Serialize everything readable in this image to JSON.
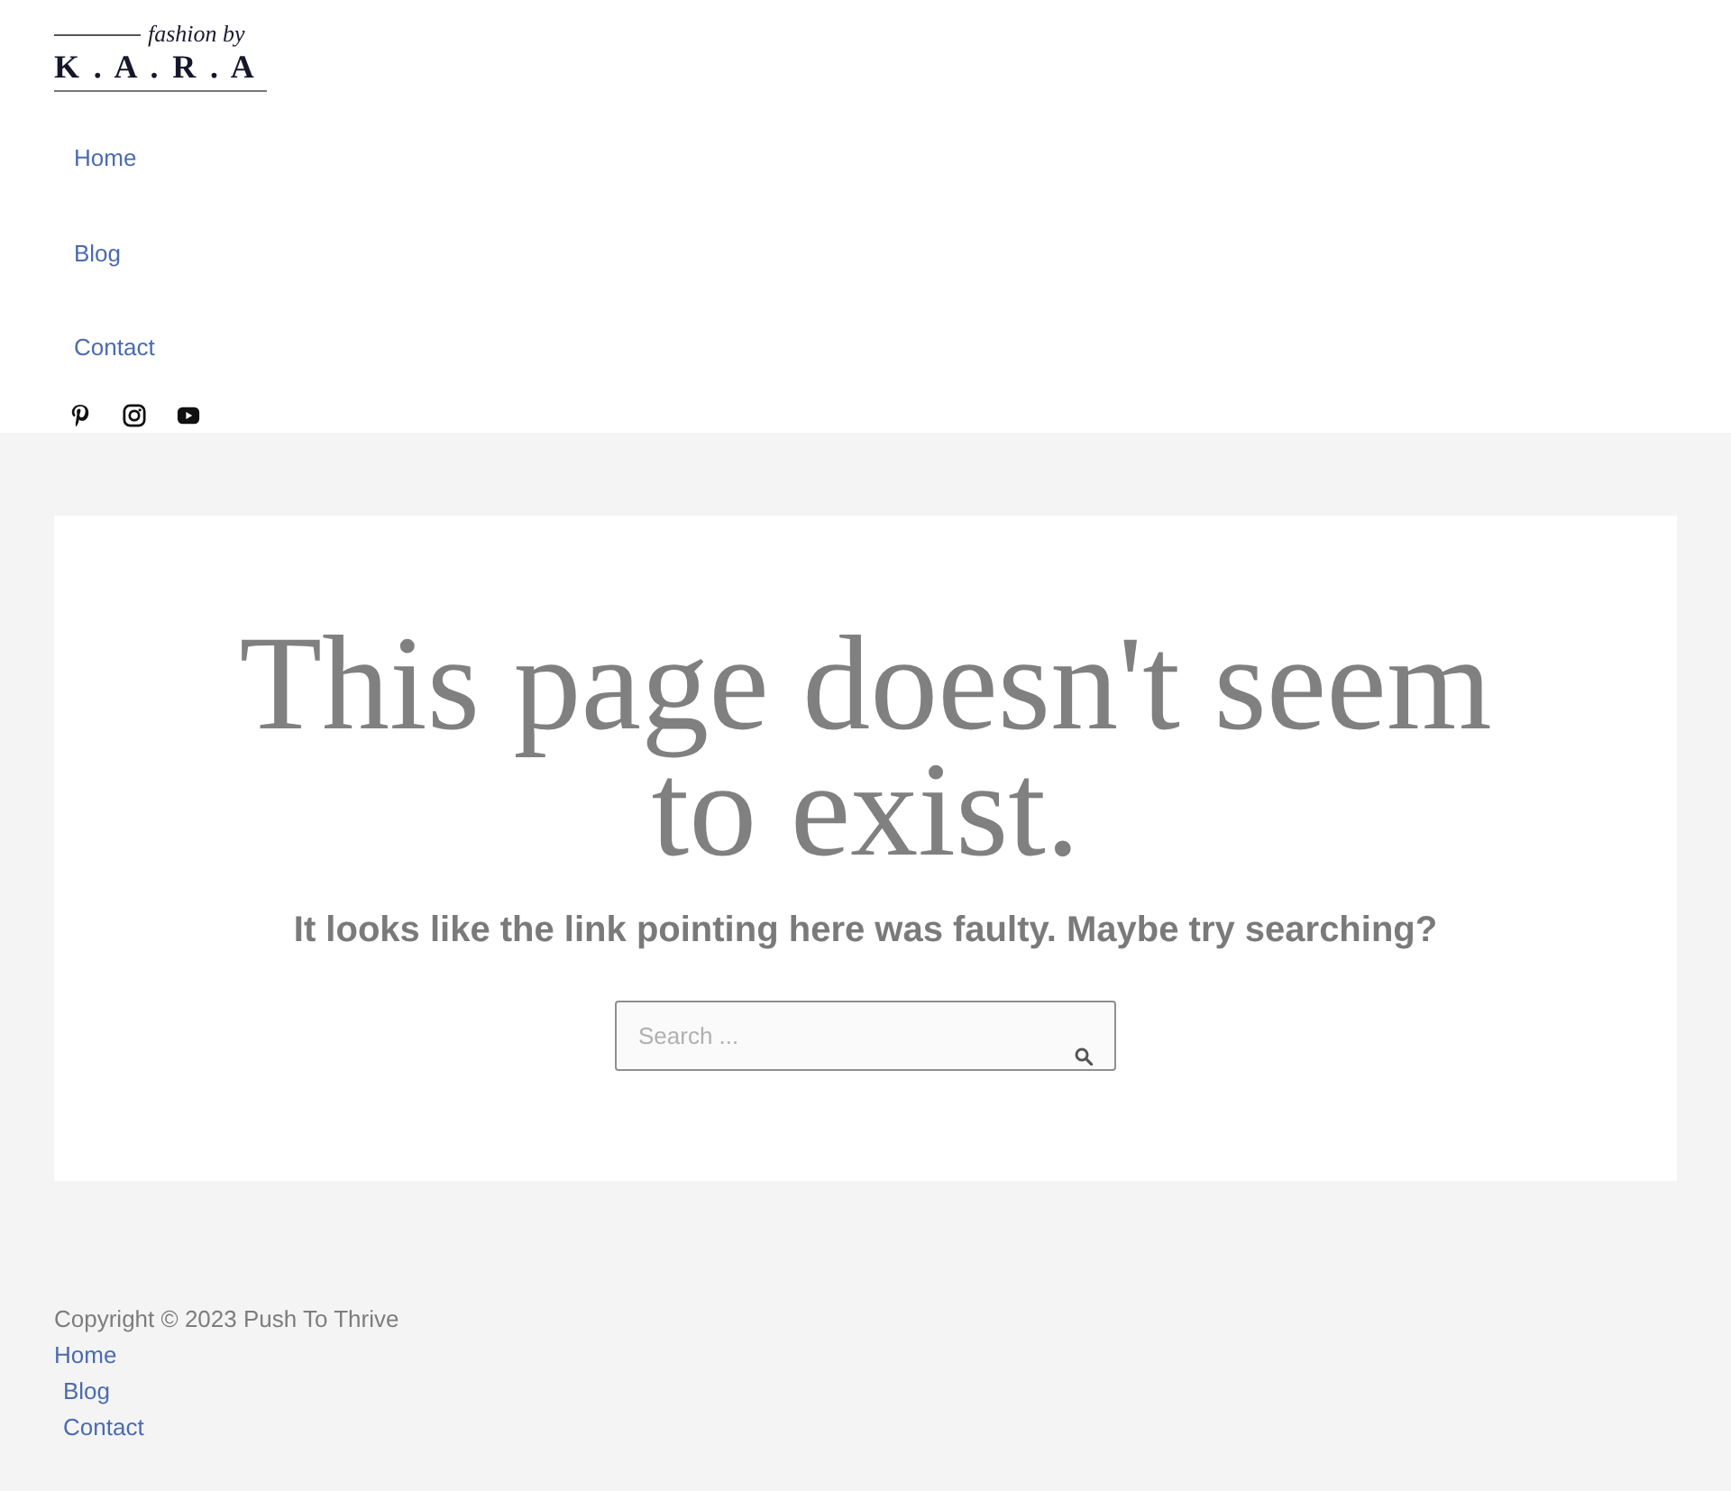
{
  "logo": {
    "tagline": "fashion by",
    "wordmark": "K . A . R . A"
  },
  "nav": [
    {
      "label": "Home"
    },
    {
      "label": "Blog"
    },
    {
      "label": "Contact"
    }
  ],
  "social": [
    {
      "kind": "pinterest"
    },
    {
      "kind": "instagram"
    },
    {
      "kind": "youtube"
    }
  ],
  "error": {
    "title": "This page doesn't seem to exist.",
    "message": "It looks like the link pointing here was faulty. Maybe try searching?",
    "search": {
      "placeholder": "Search ..."
    }
  },
  "footer": {
    "copyright": "Copyright © 2023 Push To Thrive",
    "links": [
      {
        "label": "Home"
      },
      {
        "label": "Blog"
      },
      {
        "label": "Contact"
      }
    ]
  }
}
